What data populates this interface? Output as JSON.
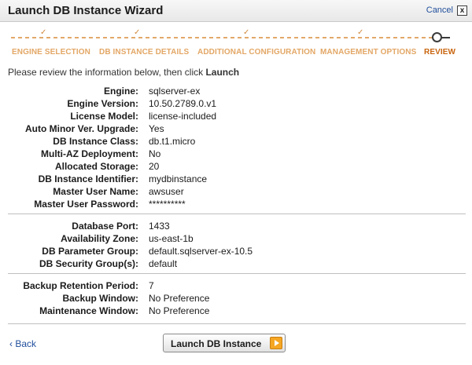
{
  "window": {
    "title": "Launch DB Instance Wizard",
    "cancel_label": "Cancel",
    "close_glyph": "x"
  },
  "steps": [
    {
      "label": "ENGINE SELECTION",
      "status": "done"
    },
    {
      "label": "DB INSTANCE DETAILS",
      "status": "done"
    },
    {
      "label": "ADDITIONAL CONFIGURATION",
      "status": "done"
    },
    {
      "label": "MANAGEMENT OPTIONS",
      "status": "done"
    },
    {
      "label": "REVIEW",
      "status": "current"
    }
  ],
  "check_glyph": "✓",
  "intro": {
    "text": "Please review the information below, then click ",
    "emphasis": "Launch"
  },
  "sections": [
    [
      {
        "label": "Engine:",
        "value": "sqlserver-ex"
      },
      {
        "label": "Engine Version:",
        "value": "10.50.2789.0.v1"
      },
      {
        "label": "License Model:",
        "value": "license-included"
      },
      {
        "label": "Auto Minor Ver. Upgrade:",
        "value": "Yes"
      },
      {
        "label": "DB Instance Class:",
        "value": "db.t1.micro"
      },
      {
        "label": "Multi-AZ Deployment:",
        "value": "No"
      },
      {
        "label": "Allocated Storage:",
        "value": "20"
      },
      {
        "label": "DB Instance Identifier:",
        "value": "mydbinstance"
      },
      {
        "label": "Master User Name:",
        "value": "awsuser"
      },
      {
        "label": "Master User Password:",
        "value": "**********"
      }
    ],
    [
      {
        "label": "Database Port:",
        "value": "1433"
      },
      {
        "label": "Availability Zone:",
        "value": "us-east-1b"
      },
      {
        "label": "DB Parameter Group:",
        "value": "default.sqlserver-ex-10.5"
      },
      {
        "label": "DB Security Group(s):",
        "value": "default"
      }
    ],
    [
      {
        "label": "Backup Retention Period:",
        "value": "7"
      },
      {
        "label": "Backup Window:",
        "value": "No Preference"
      },
      {
        "label": "Maintenance Window:",
        "value": "No Preference"
      }
    ]
  ],
  "footer": {
    "back_label": "‹ Back",
    "launch_label": "Launch DB Instance"
  },
  "colors": {
    "link": "#1f4e9c",
    "step_done": "#e3a766",
    "step_current": "#c9650f",
    "launch_arrow": "#f5a623"
  }
}
